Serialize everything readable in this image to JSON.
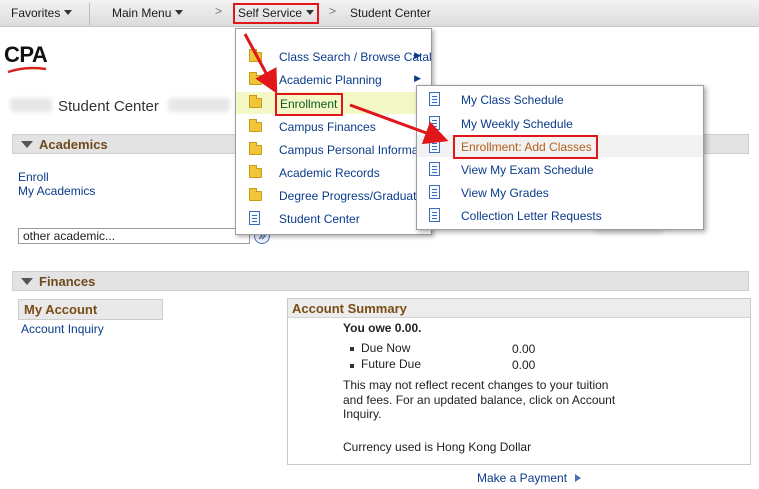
{
  "nav": {
    "favorites": "Favorites",
    "main_menu": "Main Menu",
    "self_service": "Self Service",
    "student_center": "Student Center",
    "sep": ">"
  },
  "logo": "CPA",
  "page_title": "Student Center",
  "academics": {
    "header": "Academics",
    "links": [
      "Enroll",
      "My Academics"
    ],
    "select_value": "other academic..."
  },
  "self_service_menu": {
    "items": [
      {
        "label": "Class Search / Browse Catalog",
        "icon": "folder-icon",
        "submenu": true
      },
      {
        "label": "Academic Planning",
        "icon": "folder-icon",
        "submenu": true
      },
      {
        "label": "Enrollment",
        "icon": "folder-icon",
        "submenu": false
      },
      {
        "label": "Campus Finances",
        "icon": "folder-icon",
        "submenu": false
      },
      {
        "label": "Campus Personal Informa",
        "icon": "folder-icon",
        "submenu": false
      },
      {
        "label": "Academic Records",
        "icon": "folder-icon",
        "submenu": false
      },
      {
        "label": "Degree Progress/Graduat",
        "icon": "folder-icon",
        "submenu": false
      },
      {
        "label": "Student Center",
        "icon": "document-icon",
        "submenu": false
      }
    ]
  },
  "enrollment_menu": {
    "items": [
      "My Class Schedule",
      "My Weekly Schedule",
      "Enrollment: Add Classes",
      "View My Exam Schedule",
      "View My Grades",
      "Collection Letter Requests"
    ]
  },
  "finances": {
    "header": "Finances",
    "my_account_header": "My Account",
    "account_inquiry": "Account Inquiry",
    "summary": {
      "header": "Account Summary",
      "you_owe": "You owe 0.00.",
      "due_now_label": "Due Now",
      "due_now_value": "0.00",
      "future_due_label": "Future Due",
      "future_due_value": "0.00",
      "note_line1": "This may not reflect recent changes to your tuition",
      "note_line2": "and fees.  For an updated balance, click on Account",
      "note_line3": "Inquiry.",
      "currency": "Currency used is Hong Kong Dollar"
    },
    "make_payment": "Make a Payment"
  },
  "colors": {
    "highlight": "#e0161b",
    "link": "#0a3b8a",
    "section_title": "#6e4b1c",
    "enrollment_row_bg": "#f4f7c6"
  }
}
